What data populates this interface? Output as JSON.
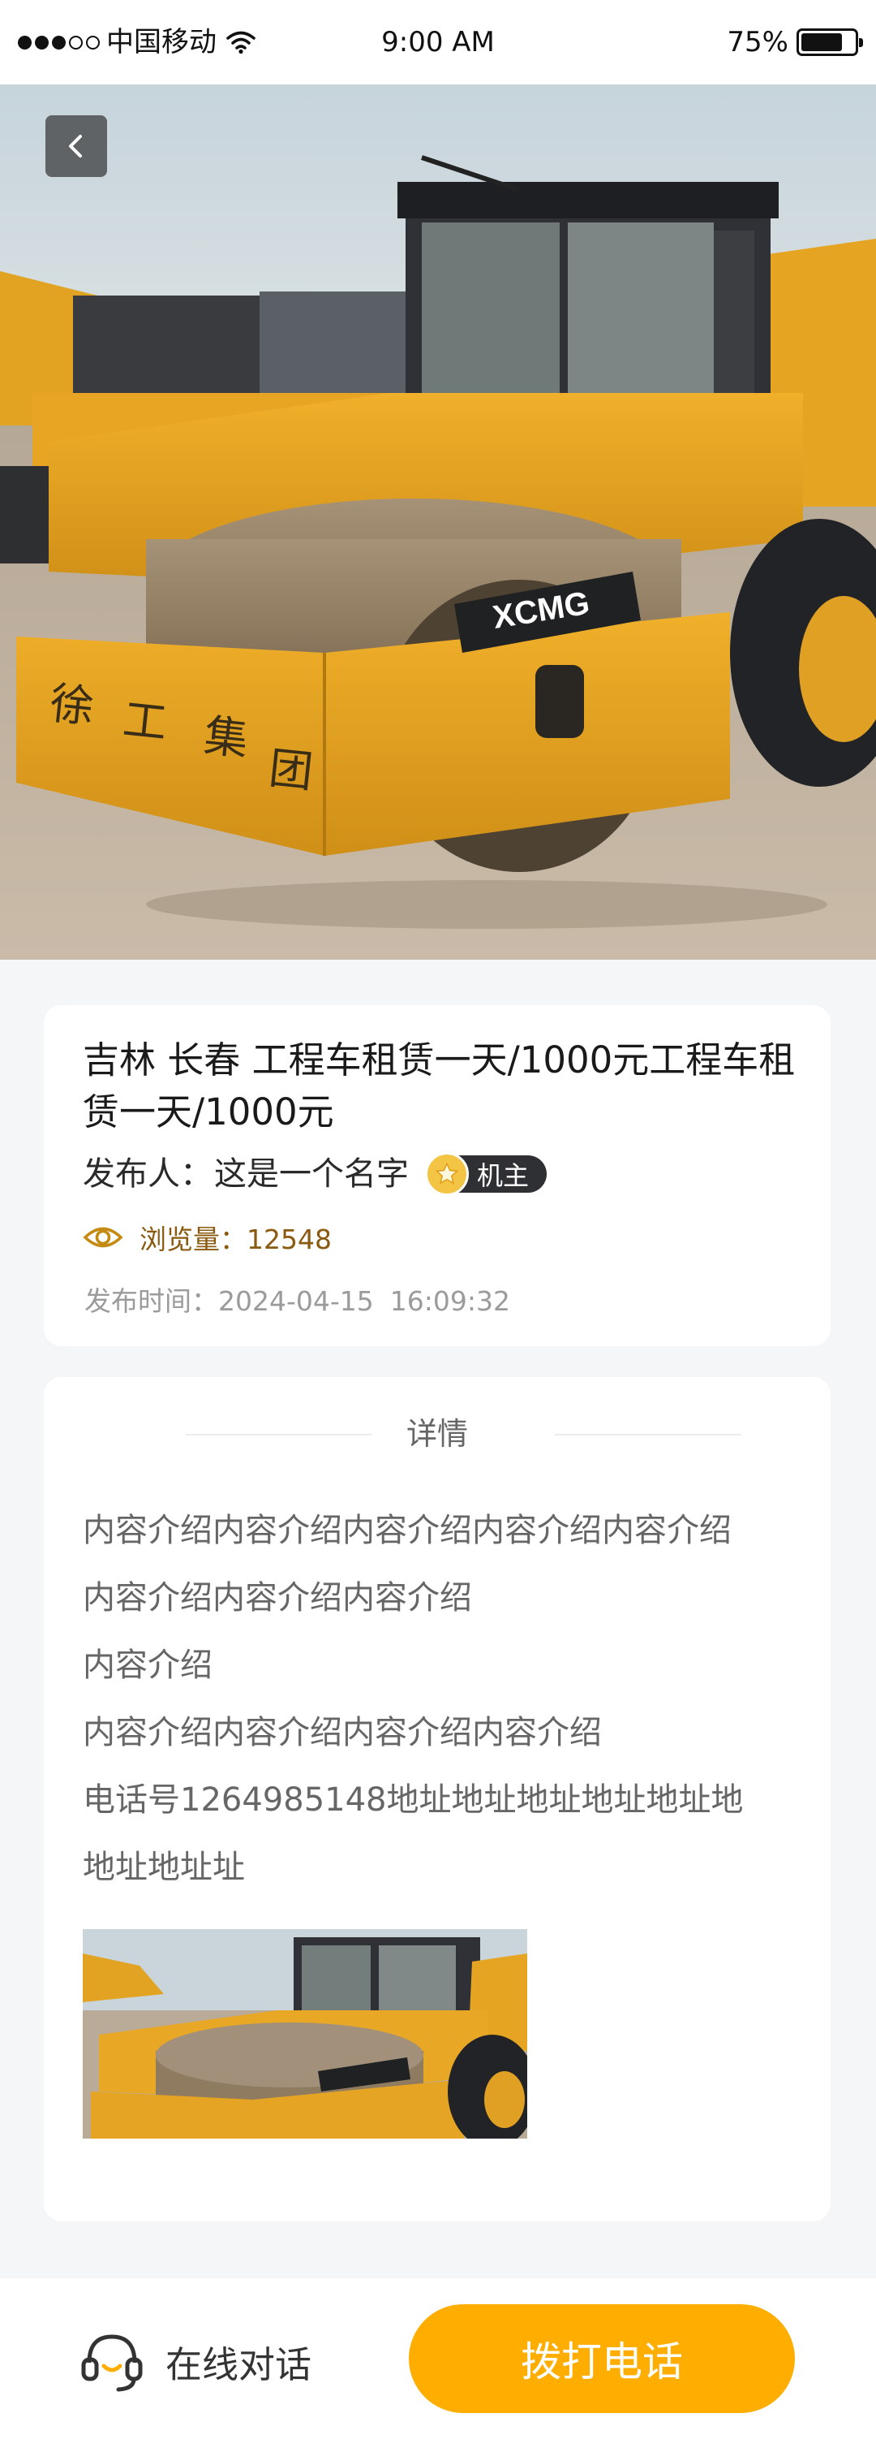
{
  "status_bar": {
    "carrier": "中国移动",
    "time": "9:00 AM",
    "battery": "75%",
    "battery_level": 0.75
  },
  "hero": {
    "back_icon": "chevron-left-icon",
    "image": "yellow-road-roller-photo",
    "brand_mark": "XCMG"
  },
  "listing": {
    "title": "吉林 长春 工程车租赁一天/1000元工程车租赁一天/1000元",
    "publisher_label": "发布人：",
    "publisher_name": "这是一个名字",
    "role_badge": "机主",
    "views_label": "浏览量：",
    "views_count": "12548",
    "publish_time_label": "发布时间：",
    "publish_date": "2024-04-15",
    "publish_clock": "16:09:32"
  },
  "detail": {
    "heading": "详情",
    "lines": [
      "内容介绍内容介绍内容介绍内容介绍内容介绍",
      "内容介绍内容介绍内容介绍",
      "内容介绍",
      "内容介绍内容介绍内容介绍内容介绍",
      "电话号1264985148地址地址地址地址地址地",
      "地址地址址"
    ]
  },
  "bottom_bar": {
    "chat_label": "在线对话",
    "call_label": "拨打电话",
    "accent_color": "#ffae00"
  }
}
